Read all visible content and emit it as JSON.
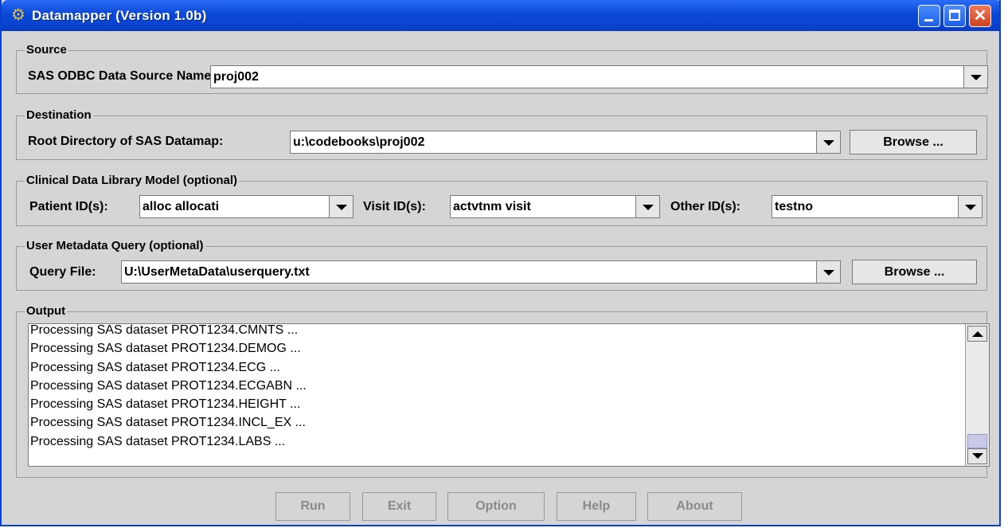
{
  "window": {
    "title": "Datamapper (Version 1.0b)",
    "icon": "datamapper-app-icon",
    "controls": [
      "minimize-icon",
      "maximize-icon",
      "close-icon"
    ]
  },
  "source": {
    "legend": "Source",
    "label": "SAS ODBC Data Source Name:",
    "value": "proj002"
  },
  "destination": {
    "legend": "Destination",
    "label": "Root Directory of SAS Datamap:",
    "value": "u:\\codebooks\\proj002",
    "browse_label": "Browse ..."
  },
  "cdlm": {
    "legend": "Clinical Data Library Model (optional)",
    "patient_label": "Patient ID(s):",
    "patient_value": "alloc allocati",
    "visit_label": "Visit ID(s):",
    "visit_value": "actvtnm visit",
    "other_label": "Other ID(s):",
    "other_value": "testno"
  },
  "query": {
    "legend": "User Metadata Query (optional)",
    "label": "Query File:",
    "value": "U:\\UserMetaData\\userquery.txt",
    "browse_label": "Browse ..."
  },
  "output": {
    "legend": "Output",
    "lines": [
      "Processing SAS dataset PROT1234.CMNTS ...",
      "Processing SAS dataset PROT1234.DEMOG ...",
      "Processing SAS dataset PROT1234.ECG ...",
      "Processing SAS dataset PROT1234.ECGABN ...",
      "Processing SAS dataset PROT1234.HEIGHT ...",
      "Processing SAS dataset PROT1234.INCL_EX ...",
      "Processing SAS dataset PROT1234.LABS ..."
    ]
  },
  "buttons": {
    "run": "Run",
    "exit": "Exit",
    "option": "Option",
    "help": "Help",
    "about": "About"
  },
  "colors": {
    "titlebar": "#0b48d6",
    "window_bg": "#d5d5d5",
    "close_button": "#d04220",
    "disabled_text": "#8a8a8a"
  }
}
